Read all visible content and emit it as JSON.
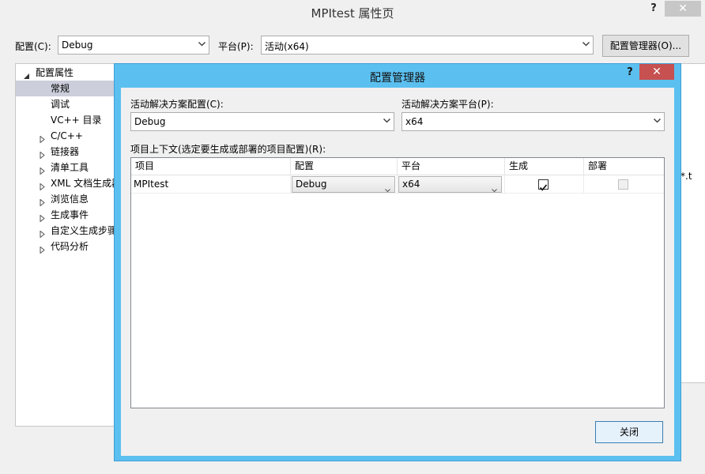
{
  "window": {
    "title": "MPItest 属性页",
    "help": "?",
    "close": "✕"
  },
  "toolbar": {
    "config_label": "配置(C):",
    "config_value": "Debug",
    "platform_label": "平台(P):",
    "platform_value": "活动(x64)",
    "manager_button": "配置管理器(O)..."
  },
  "tree": {
    "items": [
      {
        "label": "配置属性",
        "expander": "expanded"
      },
      {
        "label": "常规",
        "expander": "none"
      },
      {
        "label": "调试",
        "expander": "none"
      },
      {
        "label": "VC++ 目录",
        "expander": "none"
      },
      {
        "label": "C/C++",
        "expander": "collapsed"
      },
      {
        "label": "链接器",
        "expander": "collapsed"
      },
      {
        "label": "清单工具",
        "expander": "collapsed"
      },
      {
        "label": "XML 文档生成器",
        "expander": "collapsed"
      },
      {
        "label": "浏览信息",
        "expander": "collapsed"
      },
      {
        "label": "生成事件",
        "expander": "collapsed"
      },
      {
        "label": "自定义生成步骤",
        "expander": "collapsed"
      },
      {
        "label": "代码分析",
        "expander": "collapsed"
      }
    ],
    "selected_index": 1
  },
  "background_clip_text": "*.t",
  "dialog": {
    "title": "配置管理器",
    "help": "?",
    "close": "✕",
    "solution_config_label": "活动解决方案配置(C):",
    "solution_config_value": "Debug",
    "solution_platform_label": "活动解决方案平台(P):",
    "solution_platform_value": "x64",
    "project_context_label": "项目上下文(选定要生成或部署的项目配置)(R):",
    "columns": [
      "项目",
      "配置",
      "平台",
      "生成",
      "部署"
    ],
    "rows": [
      {
        "project": "MPItest",
        "config": "Debug",
        "platform": "x64",
        "build": true,
        "deploy": false,
        "deploy_enabled": false
      }
    ],
    "close_button": "关闭"
  },
  "colors": {
    "dialog_frame": "#5bc0f0",
    "dialog_close": "#c75050",
    "tree_selected": "#cccedb"
  }
}
